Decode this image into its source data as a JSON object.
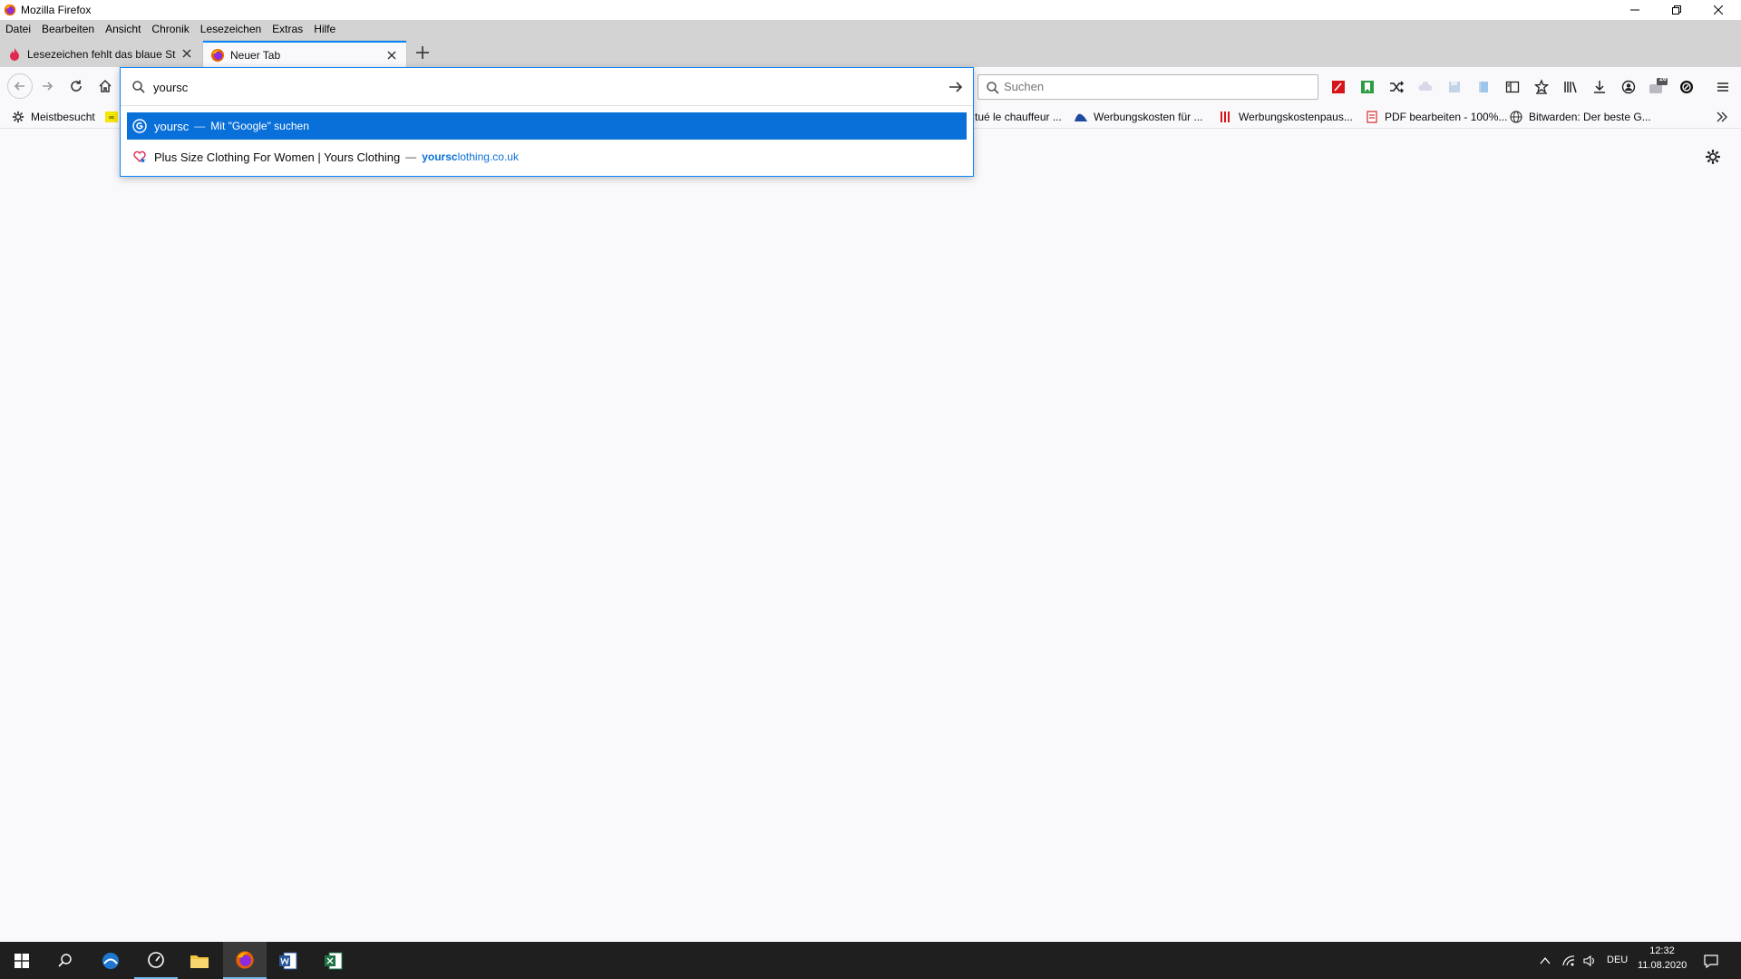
{
  "window": {
    "title": "Mozilla Firefox"
  },
  "menu": [
    "Datei",
    "Bearbeiten",
    "Ansicht",
    "Chronik",
    "Lesezeichen",
    "Extras",
    "Hilfe"
  ],
  "tabs": [
    {
      "label": "Lesezeichen fehlt das blaue Ste"
    },
    {
      "label": "Neuer Tab"
    }
  ],
  "urlbar": {
    "value": "yoursc",
    "suggestions": [
      {
        "text": "yoursc",
        "separator": "—",
        "action": "Mit \"Google\" suchen"
      },
      {
        "text": "Plus Size Clothing For Women | Yours Clothing",
        "separator": "—",
        "url_match": "yoursc",
        "url_rest": "lothing.co.uk"
      }
    ]
  },
  "searchbar": {
    "placeholder": "Suchen"
  },
  "toolbar": {
    "badge": "26"
  },
  "bookmarks": [
    {
      "label": "Meistbesucht"
    },
    {
      "label": "tué le chauffeur ..."
    },
    {
      "label": "Werbungskosten für ..."
    },
    {
      "label": "Werbungskostenpaus..."
    },
    {
      "label": "PDF bearbeiten - 100%..."
    },
    {
      "label": "Bitwarden: Der beste G..."
    }
  ],
  "tray": {
    "language": "DEU",
    "time": "12:32",
    "date": "11.08.2020"
  },
  "colors": {
    "accent": "#0a84ff",
    "selected": "#0a70d9",
    "taskbar": "#1f1f1f"
  }
}
